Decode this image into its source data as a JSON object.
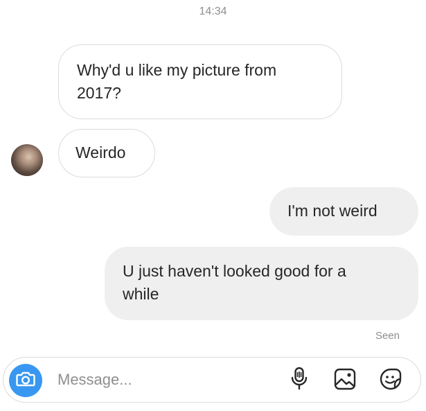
{
  "header": {
    "time": "14:34"
  },
  "messages": [
    {
      "direction": "incoming",
      "text": "Why'd u like my picture from 2017?",
      "lines": [
        "Why'd u like my picture from",
        "2017?"
      ]
    },
    {
      "direction": "incoming",
      "text": "Weirdo"
    },
    {
      "direction": "outgoing",
      "text": "I'm not weird"
    },
    {
      "direction": "outgoing",
      "text": "U just haven't looked good for a while",
      "lines": [
        "U just haven't looked good for a",
        "while"
      ]
    }
  ],
  "status": {
    "seen": "Seen"
  },
  "composer": {
    "placeholder": "Message...",
    "camera_icon": "camera-icon",
    "mic_icon": "microphone-icon",
    "gallery_icon": "image-gallery-icon",
    "sticker_icon": "sticker-icon"
  },
  "colors": {
    "accent": "#3897f0",
    "outgoing_bubble": "#efefef",
    "incoming_border": "#dbdbdb",
    "meta_text": "#8e8e8e"
  }
}
